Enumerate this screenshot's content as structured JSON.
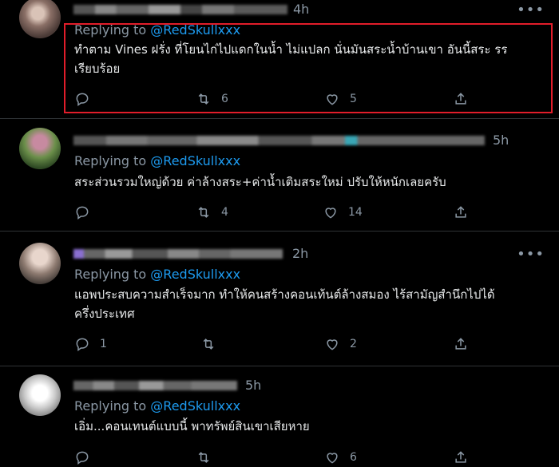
{
  "replying_label": "Replying to",
  "tweets": [
    {
      "time": "4h",
      "handle": "@RedSkullxxx",
      "text": "ทำตาม Vines ฝรั่ง ที่โยนไก่ไปแดกในน้ำ ไม่แปลก นั่นมันสระน้ำบ้านเขา อันนี้สระ รร\nเรียบร้อย",
      "replies": "",
      "retweets": "6",
      "likes": "5"
    },
    {
      "time": "5h",
      "handle": "@RedSkullxxx",
      "text": "สระส่วนรวมใหญ่ด้วย ค่าล้างสระ+ค่าน้ำเติมสระใหม่ ปรับให้หนักเลยครับ",
      "replies": "",
      "retweets": "4",
      "likes": "14"
    },
    {
      "time": "2h",
      "handle": "@RedSkullxxx",
      "text": "แอพประสบความสำเร็จมาก ทำให้คนสร้างคอนเท้นต์ล้างสมอง ไร้สามัญสำนึกไปได้\nครึ่งประเทศ",
      "replies": "1",
      "retweets": "",
      "likes": "2"
    },
    {
      "time": "5h",
      "handle": "@RedSkullxxx",
      "text": "เอิ่ม...คอนเทนต์แบบนี้ พาทรัพย์สินเขาเสียหาย",
      "replies": "",
      "retweets": "",
      "likes": "6"
    }
  ],
  "icons": [
    "reply-icon",
    "retweet-icon",
    "like-icon",
    "share-icon"
  ]
}
